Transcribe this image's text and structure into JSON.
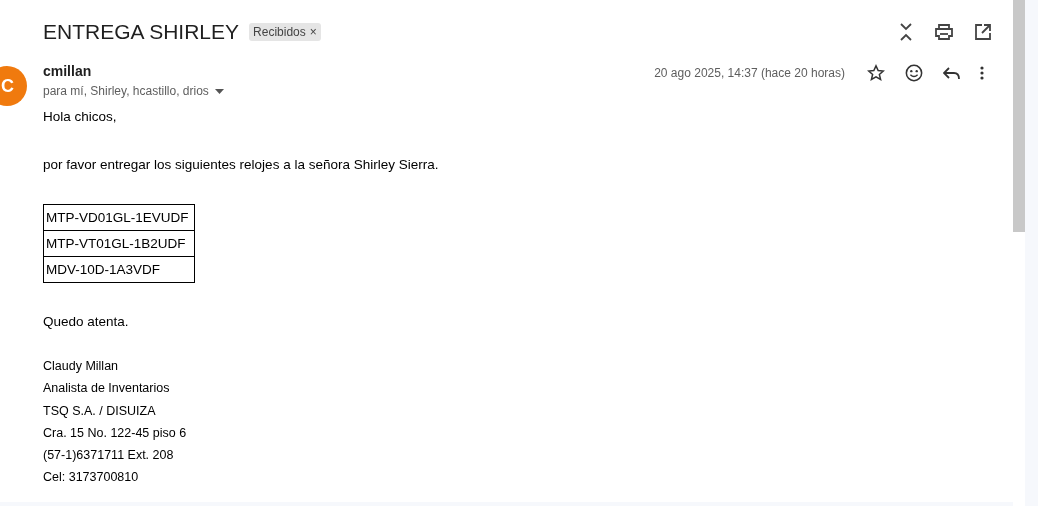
{
  "subject": "ENTREGA SHIRLEY",
  "label": {
    "text": "Recibidos",
    "remove": "×"
  },
  "message": {
    "avatar_letter": "C",
    "sender": "cmillan",
    "recipients": "para mí, Shirley, hcastillo, drios",
    "date": "20 ago 2025, 14:37 (hace 20 horas)",
    "starred": false
  },
  "body": {
    "greeting": "Hola chicos,",
    "request": "por favor entregar los siguientes relojes a la señora Shirley Sierra.",
    "table_rows": [
      "MTP-VD01GL-1EVUDF",
      "MTP-VT01GL-1B2UDF",
      "MDV-10D-1A3VDF"
    ],
    "closing": "Quedo atenta.",
    "signature": [
      "Claudy Millan",
      "Analista de Inventarios",
      "TSQ S.A. / DISUIZA",
      "Cra. 15 No. 122-45 piso 6",
      "(57-1)6371711 Ext. 208",
      "Cel: 3173700810"
    ]
  }
}
